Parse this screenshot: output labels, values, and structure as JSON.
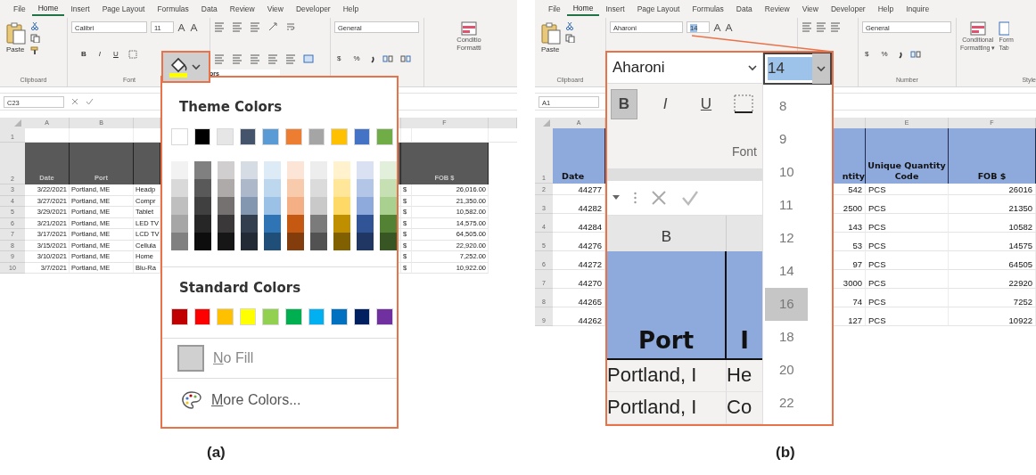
{
  "panel_a": {
    "ribbon_tabs": [
      {
        "label": "File",
        "selected": false
      },
      {
        "label": "Home",
        "selected": true
      },
      {
        "label": "Insert",
        "selected": false
      },
      {
        "label": "Page Layout",
        "selected": false
      },
      {
        "label": "Formulas",
        "selected": false
      },
      {
        "label": "Data",
        "selected": false
      },
      {
        "label": "Review",
        "selected": false
      },
      {
        "label": "View",
        "selected": false
      },
      {
        "label": "Developer",
        "selected": false
      },
      {
        "label": "Help",
        "selected": false
      }
    ],
    "clipboard": {
      "paste_label": "Paste",
      "group_label": "Clipboard"
    },
    "font": {
      "font_name": "Calibri",
      "font_size": "11",
      "buttons": [
        "B",
        "I",
        "U"
      ],
      "group_label": "Font"
    },
    "fill_button": {
      "highlighted": true
    },
    "tooltip_fragment": "ors",
    "number": {
      "format": "General",
      "buttons": [
        "$",
        "%"
      ]
    },
    "styles": {
      "lines": [
        "Conditio",
        "Formatti"
      ]
    },
    "name_box": "C23",
    "sheet": {
      "columns": [
        "A",
        "B",
        "F"
      ],
      "row_1": "1",
      "row_2": "2",
      "header": [
        "Date",
        "Port",
        "FOB $"
      ],
      "rows": [
        {
          "row": "3",
          "date": "3/22/2021",
          "port": "Portland, ME",
          "product": "Headp",
          "currency": "$",
          "fob": "26,016.00"
        },
        {
          "row": "4",
          "date": "3/27/2021",
          "port": "Portland, ME",
          "product": "Compr",
          "currency": "$",
          "fob": "21,350.00"
        },
        {
          "row": "5",
          "date": "3/29/2021",
          "port": "Portland, ME",
          "product": "Tablet",
          "currency": "$",
          "fob": "10,582.00"
        },
        {
          "row": "6",
          "date": "3/21/2021",
          "port": "Portland, ME",
          "product": "LED TV",
          "currency": "$",
          "fob": "14,575.00"
        },
        {
          "row": "7",
          "date": "3/17/2021",
          "port": "Portland, ME",
          "product": "LCD TV",
          "currency": "$",
          "fob": "64,505.00"
        },
        {
          "row": "8",
          "date": "3/15/2021",
          "port": "Portland, ME",
          "product": "Cellula",
          "currency": "$",
          "fob": "22,920.00"
        },
        {
          "row": "9",
          "date": "3/10/2021",
          "port": "Portland, ME",
          "product": "Home",
          "currency": "$",
          "fob": "7,252.00"
        },
        {
          "row": "10",
          "date": "3/7/2021",
          "port": "Portland, ME",
          "product": "Blu-Ra",
          "currency": "$",
          "fob": "10,922.00"
        }
      ]
    },
    "color_menu": {
      "theme_title": "Theme Colors",
      "theme_colors": [
        {
          "color": "#ffffff",
          "shades": [
            {
              "color": "#f2f2f2"
            },
            {
              "color": "#d9d9d9"
            },
            {
              "color": "#bfbfbf"
            },
            {
              "color": "#a6a6a6"
            },
            {
              "color": "#808080"
            }
          ]
        },
        {
          "color": "#000000",
          "shades": [
            {
              "color": "#808080"
            },
            {
              "color": "#595959"
            },
            {
              "color": "#404040"
            },
            {
              "color": "#262626"
            },
            {
              "color": "#0d0d0d"
            }
          ]
        },
        {
          "color": "#e7e6e6",
          "shades": [
            {
              "color": "#d0cece"
            },
            {
              "color": "#aeaaaa"
            },
            {
              "color": "#757171"
            },
            {
              "color": "#3a3838"
            },
            {
              "color": "#171616"
            }
          ]
        },
        {
          "color": "#44546a",
          "shades": [
            {
              "color": "#d6dce4"
            },
            {
              "color": "#adb9ca"
            },
            {
              "color": "#8497b0"
            },
            {
              "color": "#333f4f"
            },
            {
              "color": "#222b35"
            }
          ]
        },
        {
          "color": "#5b9bd5",
          "shades": [
            {
              "color": "#ddebf7"
            },
            {
              "color": "#bdd7ee"
            },
            {
              "color": "#9bc2e6"
            },
            {
              "color": "#2f75b5"
            },
            {
              "color": "#1f4e78"
            }
          ]
        },
        {
          "color": "#ed7d31",
          "shades": [
            {
              "color": "#fce4d6"
            },
            {
              "color": "#f8cbad"
            },
            {
              "color": "#f4b084"
            },
            {
              "color": "#c65911"
            },
            {
              "color": "#833c0c"
            }
          ]
        },
        {
          "color": "#a5a5a5",
          "shades": [
            {
              "color": "#ededed"
            },
            {
              "color": "#dbdbdb"
            },
            {
              "color": "#c9c9c9"
            },
            {
              "color": "#7b7b7b"
            },
            {
              "color": "#525252"
            }
          ]
        },
        {
          "color": "#ffc000",
          "shades": [
            {
              "color": "#fff2cc"
            },
            {
              "color": "#ffe699"
            },
            {
              "color": "#ffd966"
            },
            {
              "color": "#bf8f00"
            },
            {
              "color": "#806000"
            }
          ]
        },
        {
          "color": "#4472c4",
          "shades": [
            {
              "color": "#d9e1f2"
            },
            {
              "color": "#b4c6e7"
            },
            {
              "color": "#8ea9db"
            },
            {
              "color": "#305496"
            },
            {
              "color": "#203764"
            }
          ]
        },
        {
          "color": "#70ad47",
          "shades": [
            {
              "color": "#e2efda"
            },
            {
              "color": "#c6e0b4"
            },
            {
              "color": "#a9d08e"
            },
            {
              "color": "#548235"
            },
            {
              "color": "#375623"
            }
          ]
        }
      ],
      "standard_title": "Standard Colors",
      "standard_colors": [
        {
          "color": "#c00000"
        },
        {
          "color": "#ff0000"
        },
        {
          "color": "#ffc000"
        },
        {
          "color": "#ffff00"
        },
        {
          "color": "#92d050"
        },
        {
          "color": "#00b050"
        },
        {
          "color": "#00b0f0"
        },
        {
          "color": "#0070c0"
        },
        {
          "color": "#002060"
        },
        {
          "color": "#7030a0"
        }
      ],
      "no_fill": "No Fill",
      "more_colors": "More Colors..."
    },
    "caption": "(a)"
  },
  "panel_b": {
    "ribbon_tabs": [
      {
        "label": "File",
        "selected": false
      },
      {
        "label": "Home",
        "selected": true
      },
      {
        "label": "Insert",
        "selected": false
      },
      {
        "label": "Page Layout",
        "selected": false
      },
      {
        "label": "Formulas",
        "selected": false
      },
      {
        "label": "Data",
        "selected": false
      },
      {
        "label": "Review",
        "selected": false
      },
      {
        "label": "View",
        "selected": false
      },
      {
        "label": "Developer",
        "selected": false
      },
      {
        "label": "Help",
        "selected": false
      },
      {
        "label": "Inquire",
        "selected": false
      }
    ],
    "clipboard": {
      "paste_label": "Paste",
      "group_label": "Clipboard"
    },
    "font": {
      "font_name": "Aharoni",
      "font_size": "14"
    },
    "number": {
      "format": "General",
      "buttons": [
        "$",
        "%"
      ],
      "group_label": "Number"
    },
    "styles": {
      "conditional_lines": [
        "Conditional",
        "Formatting ▾"
      ],
      "format_lines": [
        "Form",
        "Tab"
      ],
      "group_label": "Style"
    },
    "name_box": "A1",
    "sheet": {
      "columns": [
        "A",
        "E",
        "F"
      ],
      "header": [
        "Date",
        "ntity",
        "Unique Quantity Code",
        "FOB $"
      ],
      "row_1": "1",
      "rows": [
        {
          "row": "2",
          "date": "44277",
          "quantity": "542",
          "unit": "PCS",
          "fob": "26016"
        },
        {
          "row": "3",
          "date": "44282",
          "quantity": "2500",
          "unit": "PCS",
          "fob": "21350"
        },
        {
          "row": "4",
          "date": "44284",
          "quantity": "143",
          "unit": "PCS",
          "fob": "10582"
        },
        {
          "row": "5",
          "date": "44276",
          "quantity": "53",
          "unit": "PCS",
          "fob": "14575"
        },
        {
          "row": "6",
          "date": "44272",
          "quantity": "97",
          "unit": "PCS",
          "fob": "64505"
        },
        {
          "row": "7",
          "date": "44270",
          "quantity": "3000",
          "unit": "PCS",
          "fob": "22920"
        },
        {
          "row": "8",
          "date": "44265",
          "quantity": "74",
          "unit": "PCS",
          "fob": "7252"
        },
        {
          "row": "9",
          "date": "44262",
          "quantity": "127",
          "unit": "PCS",
          "fob": "10922"
        }
      ]
    },
    "callout": {
      "font_name": "Aharoni",
      "font_size": "14",
      "size_text_selected": true,
      "font_buttons": [
        {
          "label": "B",
          "pressed": true
        },
        {
          "label": "I",
          "pressed": false
        },
        {
          "label": "U",
          "pressed": false
        }
      ],
      "group_label": "Font",
      "column": "B",
      "header": [
        "Port",
        "I"
      ],
      "rows": [
        [
          "Portland, I",
          "He"
        ],
        [
          "Portland, I",
          "Co"
        ]
      ],
      "size_list": [
        {
          "label": "8",
          "selected": false
        },
        {
          "label": "9",
          "selected": false
        },
        {
          "label": "10",
          "selected": false
        },
        {
          "label": "11",
          "selected": false
        },
        {
          "label": "12",
          "selected": false
        },
        {
          "label": "14",
          "selected": false
        },
        {
          "label": "16",
          "selected": true
        },
        {
          "label": "18",
          "selected": false
        },
        {
          "label": "20",
          "selected": false
        },
        {
          "label": "22",
          "selected": false
        }
      ]
    },
    "caption": "(b)"
  }
}
